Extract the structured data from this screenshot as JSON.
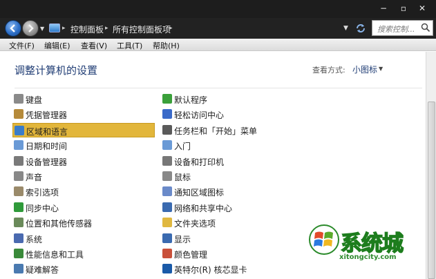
{
  "window": {
    "minimize": "−",
    "maximize": "▫",
    "close": "✕"
  },
  "address": {
    "breadcrumbs": [
      "控制面板",
      "所有控制面板项"
    ],
    "search_placeholder": "搜索控制..."
  },
  "menu": [
    "文件(F)",
    "编辑(E)",
    "查看(V)",
    "工具(T)",
    "帮助(H)"
  ],
  "content": {
    "title": "调整计算机的设置",
    "view_label": "查看方式:",
    "view_value": "小图标"
  },
  "items_left": [
    {
      "label": "键盘",
      "icon": "keyboard-icon",
      "color": "#8a8a8a"
    },
    {
      "label": "凭据管理器",
      "icon": "credential-icon",
      "color": "#b58a3a"
    },
    {
      "label": "区域和语言",
      "icon": "globe-icon",
      "color": "#3a7cc9",
      "selected": true
    },
    {
      "label": "日期和时间",
      "icon": "clock-icon",
      "color": "#6a9ad6"
    },
    {
      "label": "设备管理器",
      "icon": "device-manager-icon",
      "color": "#7a7a7a"
    },
    {
      "label": "声音",
      "icon": "speaker-icon",
      "color": "#888"
    },
    {
      "label": "索引选项",
      "icon": "index-icon",
      "color": "#9a8a6a"
    },
    {
      "label": "同步中心",
      "icon": "sync-icon",
      "color": "#2f9a3a"
    },
    {
      "label": "位置和其他传感器",
      "icon": "sensor-icon",
      "color": "#6a8a5a"
    },
    {
      "label": "系统",
      "icon": "system-icon",
      "color": "#4a6ab0"
    },
    {
      "label": "性能信息和工具",
      "icon": "performance-icon",
      "color": "#3a8a3a"
    },
    {
      "label": "疑难解答",
      "icon": "troubleshoot-icon",
      "color": "#4a7ab0"
    }
  ],
  "items_right": [
    {
      "label": "默认程序",
      "icon": "default-programs-icon",
      "color": "#3aa03a"
    },
    {
      "label": "轻松访问中心",
      "icon": "ease-of-access-icon",
      "color": "#3a6ac9"
    },
    {
      "label": "任务栏和「开始」菜单",
      "icon": "taskbar-icon",
      "color": "#5a5a5a"
    },
    {
      "label": "入门",
      "icon": "getting-started-icon",
      "color": "#6a9ad6"
    },
    {
      "label": "设备和打印机",
      "icon": "printer-icon",
      "color": "#777"
    },
    {
      "label": "鼠标",
      "icon": "mouse-icon",
      "color": "#888"
    },
    {
      "label": "通知区域图标",
      "icon": "notification-icon",
      "color": "#6a8ac9"
    },
    {
      "label": "网络和共享中心",
      "icon": "network-icon",
      "color": "#3a6ab0"
    },
    {
      "label": "文件夹选项",
      "icon": "folder-icon",
      "color": "#e0b840"
    },
    {
      "label": "显示",
      "icon": "display-icon",
      "color": "#3a6ab0"
    },
    {
      "label": "颜色管理",
      "icon": "color-management-icon",
      "color": "#c9503a"
    },
    {
      "label": "英特尔(R) 核芯显卡",
      "icon": "intel-graphics-icon",
      "color": "#1a5aa8"
    }
  ],
  "watermark": {
    "text": "系统城",
    "url": "xitongcity.com"
  }
}
